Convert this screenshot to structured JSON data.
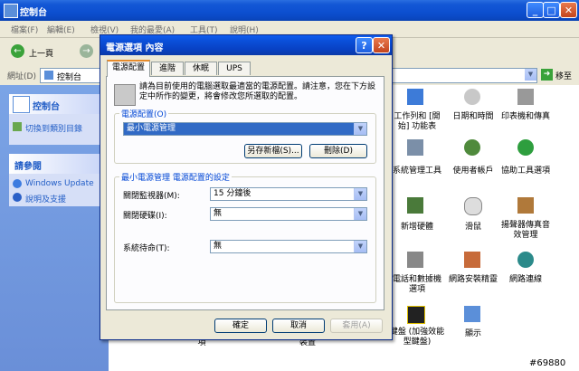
{
  "window": {
    "title": "控制台"
  },
  "menu": [
    "檔案(F)",
    "編輯(E)",
    "檢視(V)",
    "我的最愛(A)",
    "工具(T)",
    "說明(H)"
  ],
  "toolbar": {
    "back_label": "上一頁"
  },
  "address": {
    "label": "網址(D)",
    "value": "控制台",
    "go_label": "移至"
  },
  "taskpane": {
    "cp_title": "控制台",
    "switch_link": "切換到類別目錄",
    "see_also_title": "請參閱",
    "see_also": [
      "Windows Update",
      "說明及支援"
    ]
  },
  "icons": [
    {
      "label": "工作列和 [開始] 功能表"
    },
    {
      "label": "日期和時間"
    },
    {
      "label": "印表機和傳真"
    },
    {
      "label": "系統管理工具"
    },
    {
      "label": "使用者帳戶"
    },
    {
      "label": "協助工具選項"
    },
    {
      "label": "新增硬體"
    },
    {
      "label": "滑鼠"
    },
    {
      "label": "揚聲器傳真音效管理"
    },
    {
      "label": "電話和數據機選項"
    },
    {
      "label": "網路安裝精靈"
    },
    {
      "label": "網路連線"
    },
    {
      "label": "鍵盤 (加強效能型鍵盤)"
    },
    {
      "label": "顯示"
    },
    {
      "label": "項"
    },
    {
      "label": "裝置"
    }
  ],
  "dialog": {
    "title": "電源選項 內容",
    "tabs": [
      "電源配置",
      "進階",
      "休眠",
      "UPS"
    ],
    "description": "請為目前使用的電腦選取最適當的電源配置。請注意，您在下方設定中所作的變更，將會修改您所選取的配置。",
    "scheme_group": "電源配置(O)",
    "scheme_value": "最小電源管理",
    "save_as_label": "另存新檔(S)...",
    "delete_label": "刪除(D)",
    "settings_group": "最小電源管理 電源配置的設定",
    "settings": [
      {
        "label": "關閉監視器(M):",
        "value": "15 分鐘後"
      },
      {
        "label": "關閉硬碟(I):",
        "value": "無"
      },
      {
        "label": "系統待命(T):",
        "value": "無"
      }
    ],
    "ok_label": "確定",
    "cancel_label": "取消",
    "apply_label": "套用(A)"
  },
  "watermark": "#69880"
}
